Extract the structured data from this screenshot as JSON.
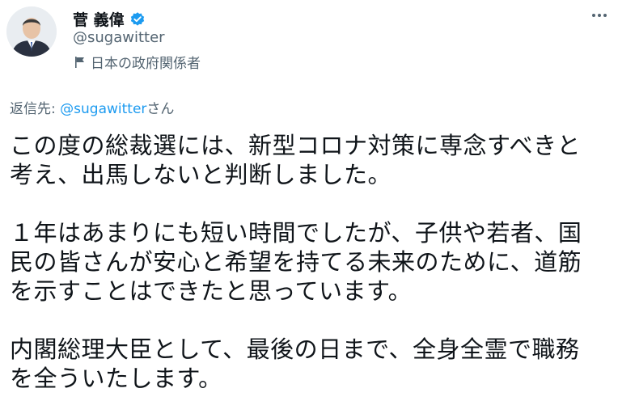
{
  "author": {
    "display_name": "菅 義偉",
    "handle": "@sugawitter",
    "label": "日本の政府関係者"
  },
  "reply": {
    "prefix": "返信先: ",
    "mention": "@sugawitter",
    "suffix": "さん"
  },
  "tweet": {
    "line1": "この度の総裁選には、新型コロナ対策に専念すべきと",
    "line2": "考え、出馬しないと判断しました。",
    "line3": "１年はあまりにも短い時間でしたが、子供や若者、国",
    "line4": "民の皆さんが安心と希望を持てる未来のために、道筋",
    "line5": "を示すことはできたと思っています。",
    "line6": "内閣総理大臣として、最後の日まで、全身全霊で職務",
    "line7": "を全ういたします。"
  },
  "icons": {
    "verified": "verified-badge-icon",
    "label": "flag-icon",
    "more": "more-dots-icon"
  },
  "colors": {
    "accent": "#1d9bf0",
    "text": "#0f1419",
    "muted": "#536471"
  }
}
